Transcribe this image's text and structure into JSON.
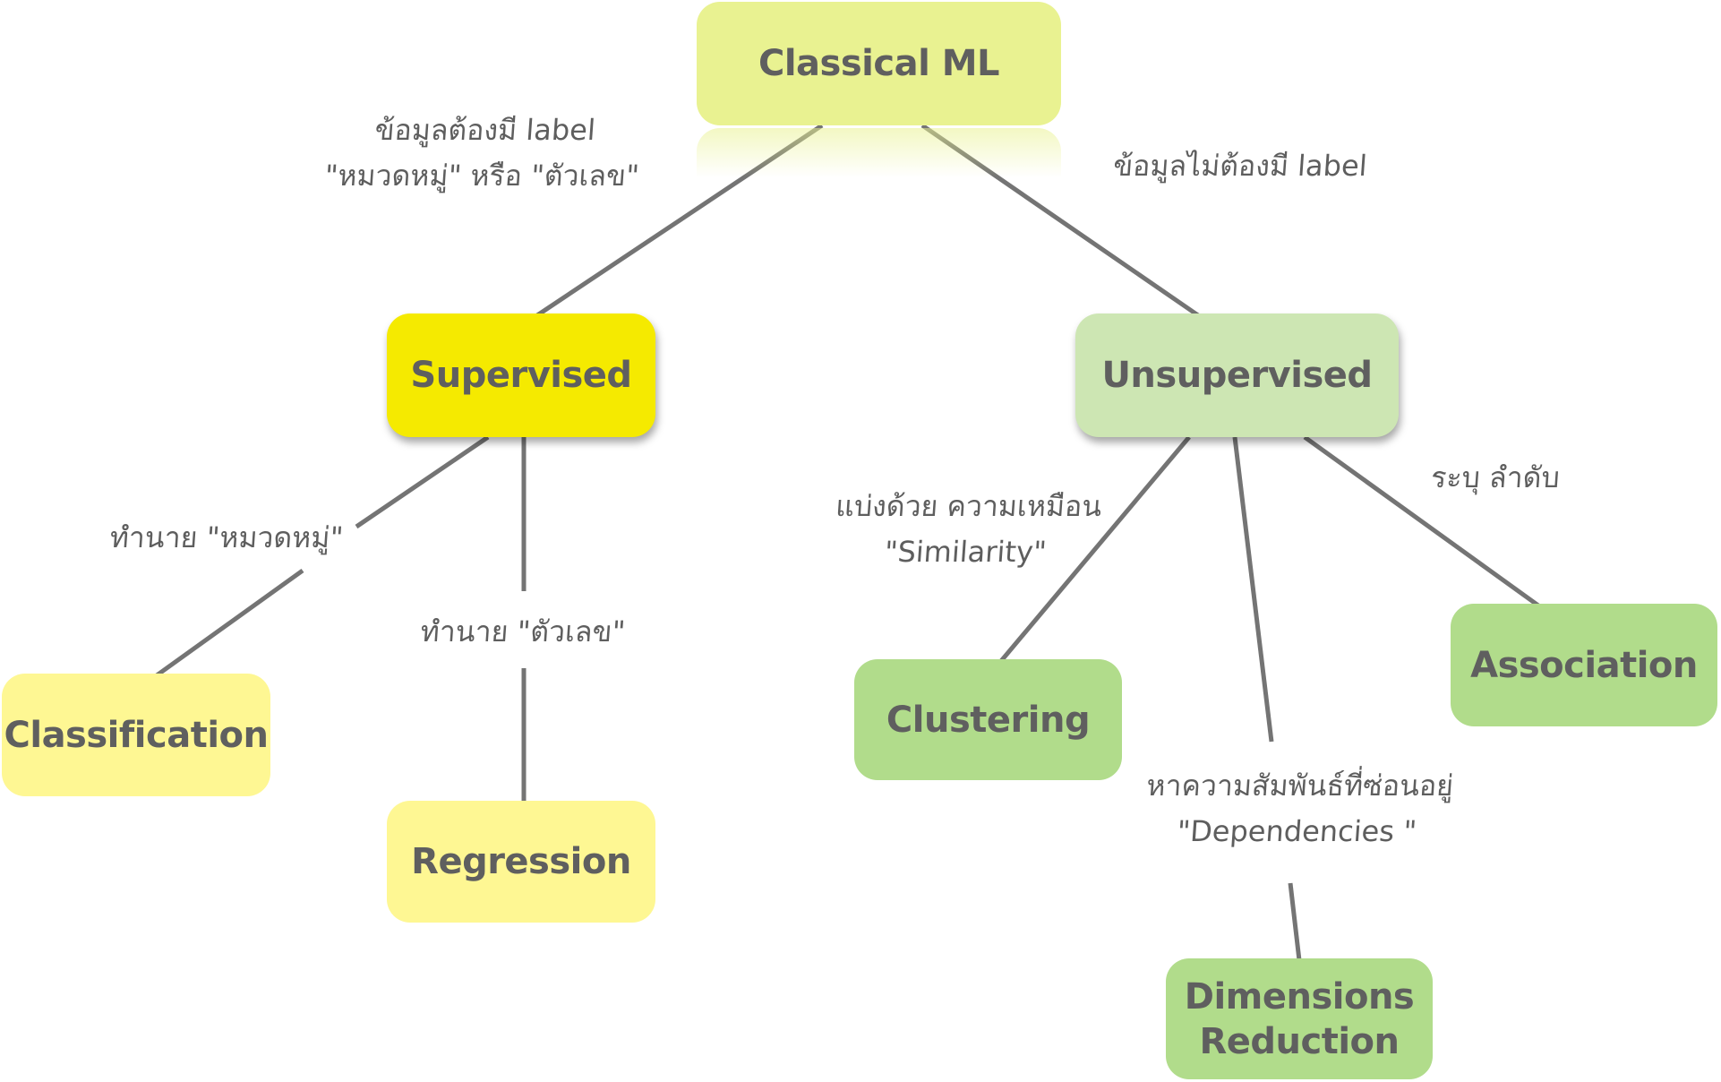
{
  "diagram": {
    "type": "tree",
    "colors": {
      "root": "#E9F291",
      "supervised": "#F5EA00",
      "supervised_children": "#FEF793",
      "unsupervised": "#CDE6B3",
      "unsupervised_children": "#B1DC8B",
      "text": "#5F5F5F",
      "edge": "#747474"
    },
    "nodes": {
      "root": {
        "label": "Classical ML"
      },
      "supervised": {
        "label": "Supervised"
      },
      "unsupervised": {
        "label": "Unsupervised"
      },
      "classification": {
        "label": "Classification"
      },
      "regression": {
        "label": "Regression"
      },
      "clustering": {
        "label": "Clustering"
      },
      "association": {
        "label": "Association"
      },
      "dimensions_reduction": {
        "label_line1": "Dimensions",
        "label_line2": "Reduction"
      }
    },
    "edges": [
      {
        "from": "root",
        "to": "supervised",
        "label_line1": "ข้อมูลต้องมี label",
        "label_line2": "\"หมวดหมู่\" หรือ \"ตัวเลข\""
      },
      {
        "from": "root",
        "to": "unsupervised",
        "label_line1": "ข้อมูลไม่ต้องมี label"
      },
      {
        "from": "supervised",
        "to": "classification",
        "label_line1": "ทำนาย \"หมวดหมู่\""
      },
      {
        "from": "supervised",
        "to": "regression",
        "label_line1": "ทำนาย \"ตัวเลข\""
      },
      {
        "from": "unsupervised",
        "to": "clustering",
        "label_line1": "แบ่งด้วย ความเหมือน",
        "label_line2": "\"Similarity\""
      },
      {
        "from": "unsupervised",
        "to": "dimensions_reduction",
        "label_line1": "หาความสัมพันธ์ที่ซ่อนอยู่",
        "label_line2": "\"Dependencies \""
      },
      {
        "from": "unsupervised",
        "to": "association",
        "label_line1": "ระบุ ลำดับ"
      }
    ]
  }
}
